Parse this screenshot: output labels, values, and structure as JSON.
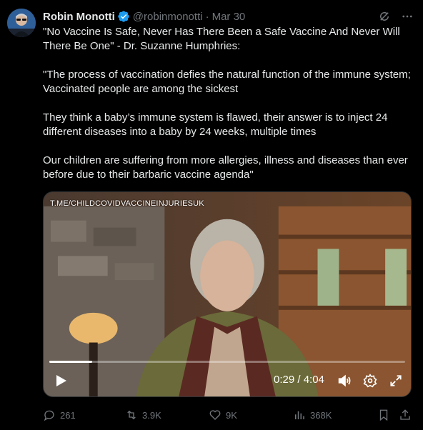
{
  "author": {
    "name": "Robin Monotti",
    "handle": "@robinmonotti",
    "separator": "·",
    "date": "Mar 30"
  },
  "icons": {
    "verified": "verified-badge-icon",
    "grok": "grok-icon",
    "more": "more-icon"
  },
  "colors": {
    "background": "#000000",
    "text": "#e7e9ea",
    "muted": "#71767b",
    "verified": "#1d9bf0"
  },
  "tweet": {
    "paragraphs": [
      "\"No Vaccine Is Safe, Never Has There Been a Safe Vaccine And Never Will There Be One\" - Dr. Suzanne Humphries:",
      "\"The process of vaccination defies the natural function of the immune system; Vaccinated people are among the sickest",
      "They think a baby’s immune system is flawed, their answer is to inject 24 different diseases into a baby by 24 weeks, multiple times",
      "Our children are suffering from more allergies, illness and diseases than ever before due to their barbaric vaccine agenda\""
    ]
  },
  "video": {
    "watermark": "T.ME/CHILDCOVIDVACCINEINJURIESUK",
    "current_time": "0:29",
    "duration": "4:04",
    "time_display": "0:29 / 4:04",
    "progress_fraction": 0.12
  },
  "actions": {
    "replies": "261",
    "reposts": "3.9K",
    "likes": "9K",
    "views": "368K"
  }
}
